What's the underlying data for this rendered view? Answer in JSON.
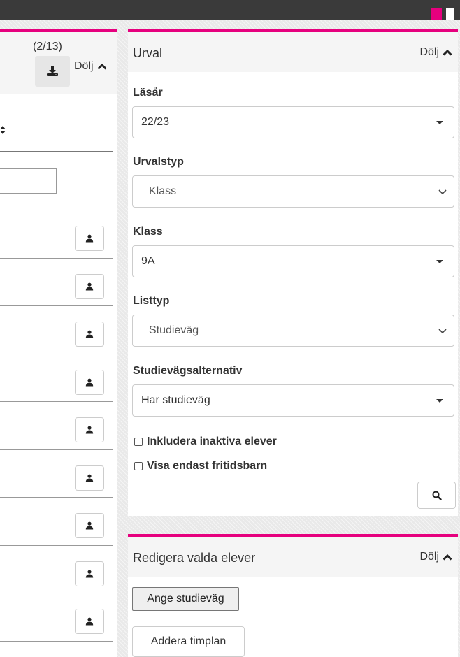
{
  "left_panel": {
    "count": "(2/13)",
    "hide_label": "Dölj",
    "row_count": 9
  },
  "urval": {
    "title": "Urval",
    "hide_label": "Dölj",
    "lasar_label": "Läsår",
    "lasar_value": "22/23",
    "urvalstyp_label": "Urvalstyp",
    "urvalstyp_value": "Klass",
    "klass_label": "Klass",
    "klass_value": "9A",
    "listtyp_label": "Listtyp",
    "listtyp_value": "Studieväg",
    "studievag_label": "Studievägsalternativ",
    "studievag_value": "Har studieväg",
    "inkludera_label": "Inkludera inaktiva elever",
    "inkludera_checked": false,
    "fritids_label": "Visa endast fritidsbarn",
    "fritids_checked": false
  },
  "redigera": {
    "title": "Redigera valda elever",
    "hide_label": "Dölj",
    "ange_label": "Ange studieväg",
    "addera_label": "Addera timplan"
  },
  "colors": {
    "accent": "#e6007e",
    "topbar": "#3a3a3a",
    "panel_header": "#f5f5f5"
  }
}
